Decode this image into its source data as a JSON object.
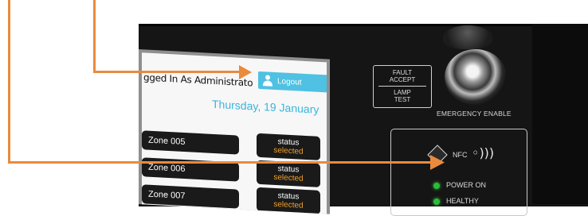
{
  "screen": {
    "login_text": "gged In As Administrato",
    "logout_label": "Logout",
    "date": "Thursday, 19 January",
    "zones": [
      {
        "name": "Zone 005",
        "status_label": "status",
        "status_value": "selected"
      },
      {
        "name": "Zone 006",
        "status_label": "status",
        "status_value": "selected"
      },
      {
        "name": "Zone 007",
        "status_label": "status",
        "status_value": "selected"
      }
    ]
  },
  "panel": {
    "fault_accept_line1": "FAULT",
    "fault_accept_line2": "ACCEPT",
    "lamp_test_line1": "LAMP",
    "lamp_test_line2": "TEST",
    "emergency_label": "EMERGENCY ENABLE",
    "nfc_label": "NFC",
    "nfc_waves": "◦)))",
    "led_power": "POWER ON",
    "led_healthy": "HEALTHY"
  },
  "colors": {
    "accent_blue": "#4fc1e2",
    "status_orange": "#f2a12b",
    "arrow_orange": "#ea8a3c",
    "led_green": "#2bbd3a"
  },
  "icons": [
    "user-icon",
    "nfc-icon",
    "contactless-icon",
    "key-switch-icon"
  ]
}
